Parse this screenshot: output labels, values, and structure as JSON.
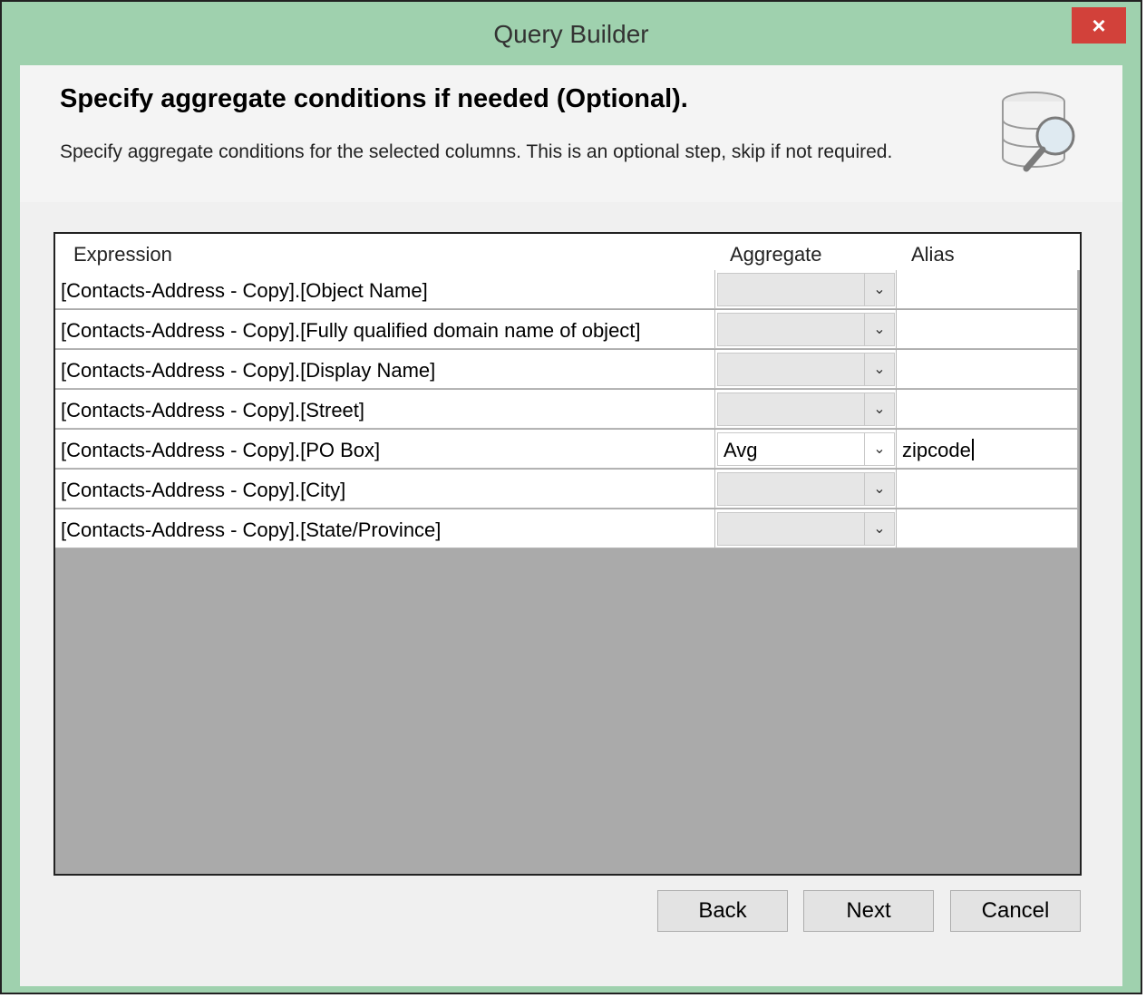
{
  "window": {
    "title": "Query Builder",
    "close_label": "×"
  },
  "header": {
    "heading": "Specify aggregate conditions if needed (Optional).",
    "subheading": "Specify aggregate conditions for the selected columns. This is an optional step, skip if not required.",
    "icon": "database-search-icon"
  },
  "grid": {
    "columns": {
      "expression": "Expression",
      "aggregate": "Aggregate",
      "alias": "Alias"
    },
    "rows": [
      {
        "expression": "[Contacts-Address - Copy].[Object Name]",
        "aggregate": "",
        "alias": ""
      },
      {
        "expression": "[Contacts-Address - Copy].[Fully qualified domain name of object]",
        "aggregate": "",
        "alias": ""
      },
      {
        "expression": "[Contacts-Address - Copy].[Display Name]",
        "aggregate": "",
        "alias": ""
      },
      {
        "expression": "[Contacts-Address - Copy].[Street]",
        "aggregate": "",
        "alias": ""
      },
      {
        "expression": "[Contacts-Address - Copy].[PO Box]",
        "aggregate": "Avg",
        "alias": "zipcode"
      },
      {
        "expression": "[Contacts-Address - Copy].[City]",
        "aggregate": "",
        "alias": ""
      },
      {
        "expression": "[Contacts-Address - Copy].[State/Province]",
        "aggregate": "",
        "alias": ""
      }
    ]
  },
  "buttons": {
    "back": "Back",
    "next": "Next",
    "cancel": "Cancel"
  },
  "colors": {
    "frame": "#9fd1ae",
    "close": "#d2413a",
    "grid_background": "#aaaaaa"
  }
}
